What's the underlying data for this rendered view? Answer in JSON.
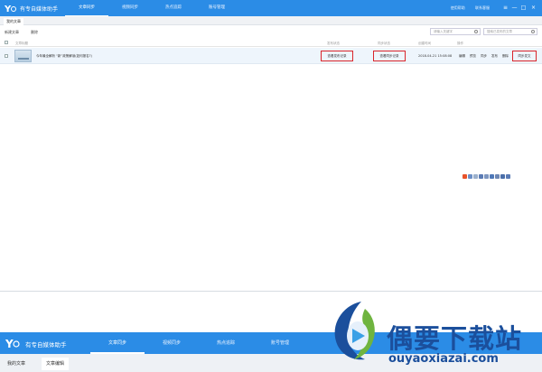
{
  "app": {
    "title": "有专自媒体助手",
    "nav": [
      "文章同步",
      "视频同步",
      "热点追踪",
      "账号管理"
    ],
    "window_links": [
      "使用帮助",
      "联系客服"
    ],
    "window_buttons": [
      "≡",
      "—",
      "□",
      "×"
    ]
  },
  "tabs": [
    "我的文章"
  ],
  "toolbar": {
    "new_article": "新建文章",
    "delete": "删除",
    "search_keyword_placeholder": "请输入关键字",
    "search_article_placeholder": "搜索已发布的文章"
  },
  "table": {
    "headers": [
      "文章标题",
      "发布状态",
      "同步状态",
      "创建时间",
      "操作"
    ],
    "rows": [
      {
        "title": "今年最全解析 “新”政策解读(如何报名?)",
        "publish_status": "查看发布记录",
        "sync_status": "查看同步记录",
        "created": "2018-04-21 15:08:08",
        "actions": [
          "编辑",
          "预览",
          "同步",
          "发布",
          "删除",
          "同步发文"
        ]
      }
    ]
  },
  "tray_icons": [
    "sogou-icon",
    "chinese-input-icon",
    "punctuation-icon",
    "moon-icon",
    "keyboard-icon",
    "mic-icon",
    "user-icon",
    "shirt-icon",
    "tools-icon"
  ],
  "bottom": {
    "title": "有专自媒体助手",
    "nav": [
      "文章同步",
      "视频同步",
      "热点追踪",
      "账号管理"
    ],
    "tabs": [
      "我的文章",
      "文章编辑"
    ]
  },
  "watermark": {
    "name": "偶要下载站",
    "url": "ouyaoxiazai.com"
  },
  "colors": {
    "primary": "#2b8ce6",
    "highlight_row": "#eef5fc",
    "callout_red": "#d9252b",
    "watermark_blue": "#1b4f9c"
  }
}
